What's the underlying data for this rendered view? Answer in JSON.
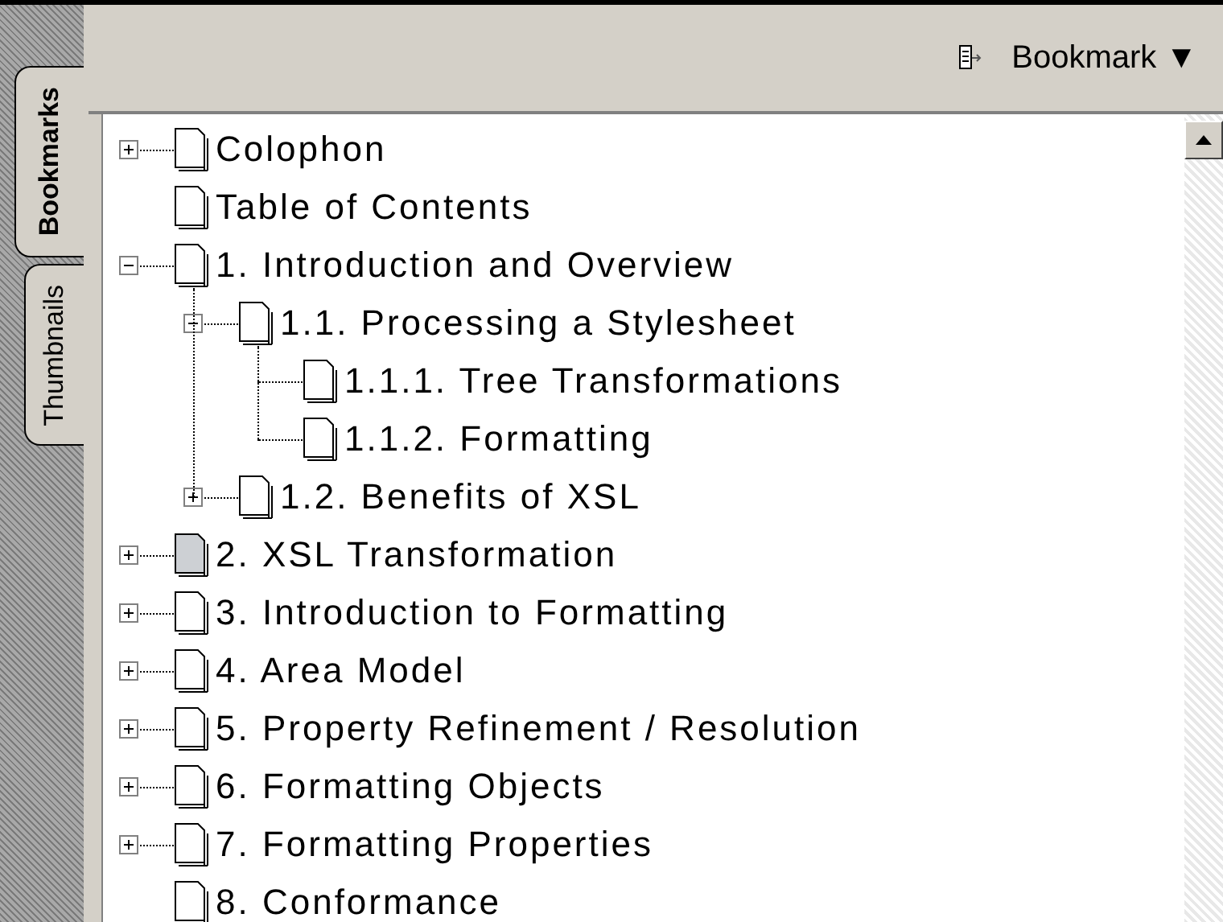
{
  "side_tabs": [
    {
      "label": "Bookmarks",
      "selected": true
    },
    {
      "label": "Thumbnails",
      "selected": false
    }
  ],
  "toolbar": {
    "menu_label": "Bookmark ▼"
  },
  "bookmarks": [
    {
      "label": "Colophon",
      "expanded": false,
      "current": false
    },
    {
      "label": "Table of Contents",
      "current": false
    },
    {
      "label": "1. Introduction and Overview",
      "expanded": true,
      "current": false,
      "children": [
        {
          "label": "1.1. Processing a Stylesheet",
          "expanded": true,
          "current": false,
          "children": [
            {
              "label": "1.1.1. Tree Transformations",
              "current": false
            },
            {
              "label": "1.1.2. Formatting",
              "current": false
            }
          ]
        },
        {
          "label": "1.2. Benefits of XSL",
          "expanded": false,
          "current": false
        }
      ]
    },
    {
      "label": "2. XSL Transformation",
      "expanded": false,
      "current": true
    },
    {
      "label": "3. Introduction to Formatting",
      "expanded": false,
      "current": false
    },
    {
      "label": "4. Area Model",
      "expanded": false,
      "current": false
    },
    {
      "label": "5. Property Refinement / Resolution",
      "expanded": false,
      "current": false
    },
    {
      "label": "6. Formatting Objects",
      "expanded": false,
      "current": false
    },
    {
      "label": "7. Formatting Properties",
      "expanded": false,
      "current": false
    },
    {
      "label": "8. Conformance",
      "current": false
    }
  ]
}
